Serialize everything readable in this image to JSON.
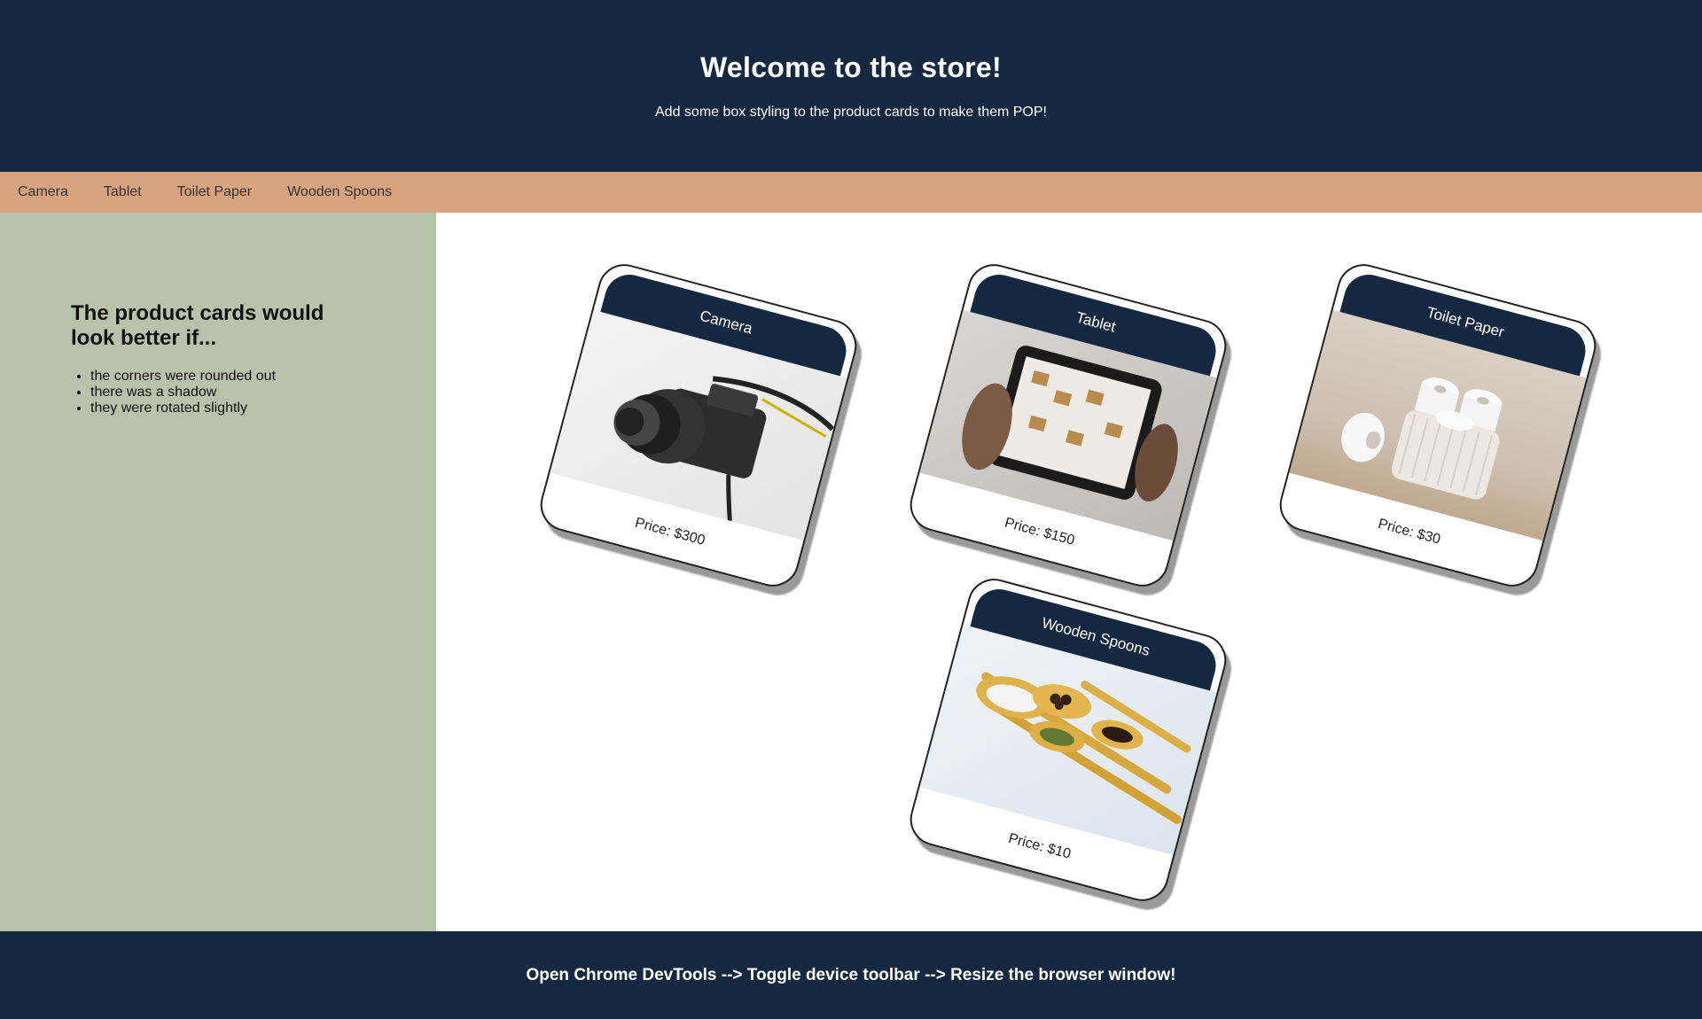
{
  "header": {
    "title": "Welcome to the store!",
    "subtitle": "Add some box styling to the product cards to make them POP!"
  },
  "nav": {
    "items": [
      "Camera",
      "Tablet",
      "Toilet Paper",
      "Wooden Spoons"
    ]
  },
  "sidebar": {
    "heading": "The product cards would look better if...",
    "tips": [
      "the corners were rounded out",
      "there was a shadow",
      "they were rotated slightly"
    ]
  },
  "products": [
    {
      "name": "Camera",
      "price": "Price: $300",
      "image_icon": "camera-photo"
    },
    {
      "name": "Tablet",
      "price": "Price: $150",
      "image_icon": "tablet-photo"
    },
    {
      "name": "Toilet Paper",
      "price": "Price: $30",
      "image_icon": "toilet-paper-photo"
    },
    {
      "name": "Wooden Spoons",
      "price": "Price: $10",
      "image_icon": "wooden-spoons-photo"
    }
  ],
  "footer": {
    "text": "Open Chrome DevTools --> Toggle device toolbar --> Resize the browser window!"
  },
  "colors": {
    "header_bg": "#14293f",
    "nav_bg": "#d8a47f",
    "sidebar_bg": "#b7c4ab",
    "footer_bg": "#14293f"
  }
}
